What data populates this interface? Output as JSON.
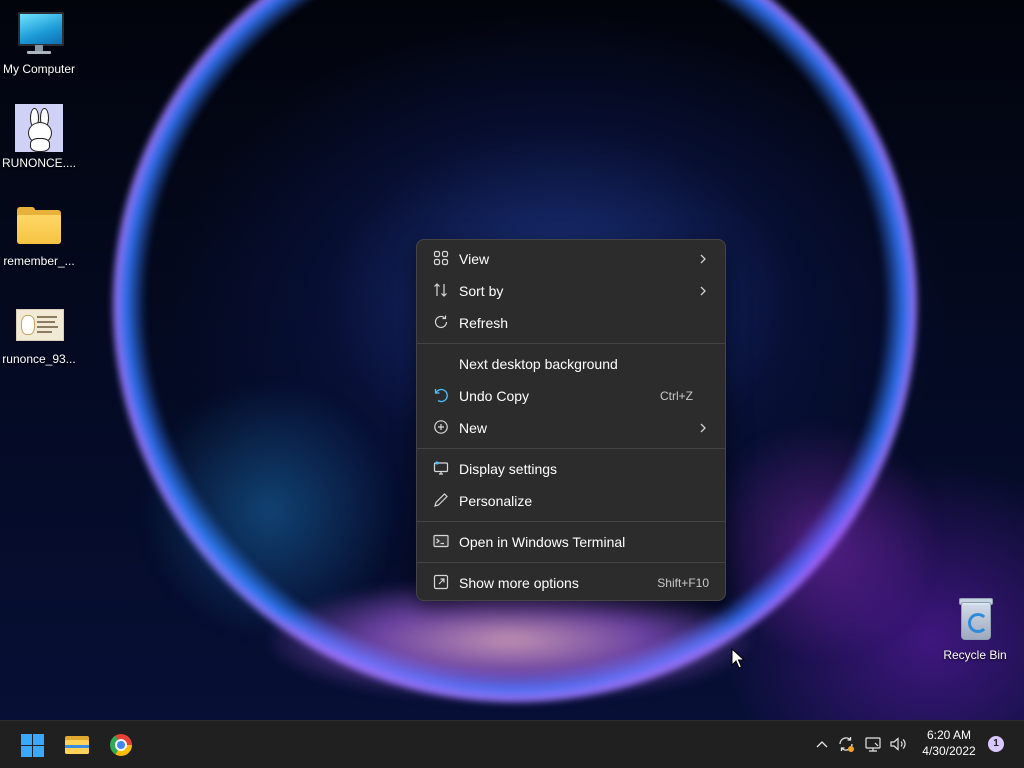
{
  "desktop": {
    "icons": [
      {
        "label": "My Computer",
        "icon": "monitor-icon"
      },
      {
        "label": "RUNONCE....",
        "icon": "bunny-image-icon"
      },
      {
        "label": "remember_...",
        "icon": "folder-icon"
      },
      {
        "label": "runonce_93...",
        "icon": "image-file-icon"
      },
      {
        "label": "Recycle Bin",
        "icon": "recycle-bin-icon"
      }
    ]
  },
  "context_menu": {
    "items": [
      {
        "label": "View",
        "icon": "view-grid-icon",
        "shortcut": "",
        "submenu": true
      },
      {
        "label": "Sort by",
        "icon": "sort-icon",
        "shortcut": "",
        "submenu": true
      },
      {
        "label": "Refresh",
        "icon": "refresh-icon",
        "shortcut": "",
        "submenu": false
      },
      {
        "label": "Next desktop background",
        "icon": "",
        "shortcut": "",
        "submenu": false
      },
      {
        "label": "Undo Copy",
        "icon": "undo-icon",
        "shortcut": "Ctrl+Z",
        "submenu": false
      },
      {
        "label": "New",
        "icon": "new-plus-icon",
        "shortcut": "",
        "submenu": true
      },
      {
        "label": "Display settings",
        "icon": "display-icon",
        "shortcut": "",
        "submenu": false
      },
      {
        "label": "Personalize",
        "icon": "pen-icon",
        "shortcut": "",
        "submenu": false
      },
      {
        "label": "Open in Windows Terminal",
        "icon": "terminal-icon",
        "shortcut": "",
        "submenu": false
      },
      {
        "label": "Show more options",
        "icon": "more-options-icon",
        "shortcut": "Shift+F10",
        "submenu": false
      }
    ]
  },
  "taskbar": {
    "pinned": [
      {
        "name": "Start",
        "icon": "windows-logo-icon"
      },
      {
        "name": "File Explorer",
        "icon": "file-explorer-icon"
      },
      {
        "name": "Google Chrome",
        "icon": "chrome-icon"
      }
    ],
    "tray": {
      "icons": [
        "chevron-up-icon",
        "sync-icon",
        "network-icon",
        "volume-icon"
      ],
      "time": "6:20 AM",
      "date": "4/30/2022",
      "notification_count": "1"
    }
  },
  "colors": {
    "menu_bg": "#2c2c2c",
    "taskbar_bg": "#202020",
    "accent": "#3aa8ff"
  }
}
